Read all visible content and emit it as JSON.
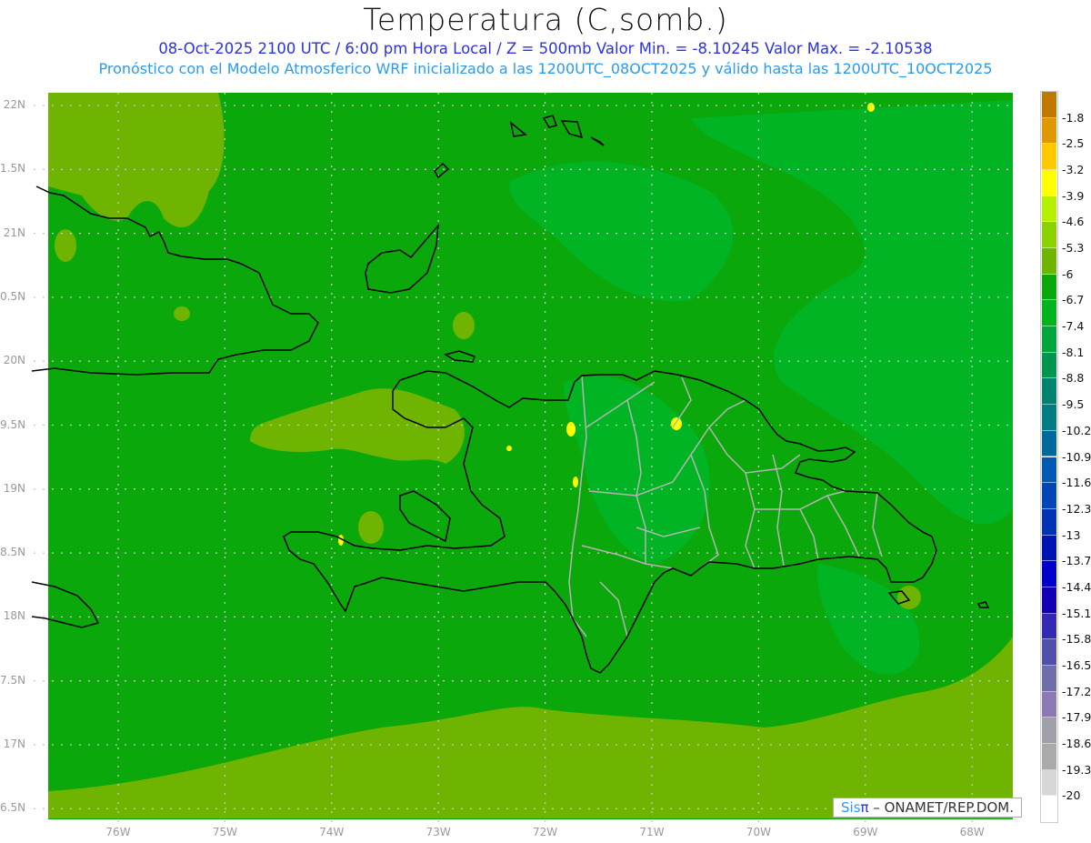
{
  "header": {
    "title": "Temperatura (C,somb.)",
    "subtitle": "08-Oct-2025  2100 UTC / 6:00 pm Hora Local / Z = 500mb  Valor Min. = -8.10245  Valor Max. = -2.10538",
    "description": "Pronóstico con el Modelo Atmosferico WRF inicializado a las 1200UTC_08OCT2025 y válido hasta las  1200UTC_10OCT2025"
  },
  "map": {
    "lat_labels": [
      "22N",
      "1.5N",
      "21N",
      "0.5N",
      "20N",
      "9.5N",
      "19N",
      "8.5N",
      "18N",
      "7.5N",
      "17N",
      "6.5N"
    ],
    "lon_labels": [
      "76W",
      "75W",
      "74W",
      "73W",
      "72W",
      "71W",
      "70W",
      "69W",
      "68W"
    ],
    "colors": {
      "base": "#0aa80a",
      "light": "#00b424",
      "warm": "#6eb400",
      "coast": "#000000",
      "provinces": "#b4b4b4"
    }
  },
  "colorbar": {
    "labels": [
      "-1.8",
      "-2.5",
      "-3.2",
      "-3.9",
      "-4.6",
      "-5.3",
      "-6",
      "-6.7",
      "-7.4",
      "-8.1",
      "-8.8",
      "-9.5",
      "-10.2",
      "-10.9",
      "-11.6",
      "-12.3",
      "-13",
      "-13.7",
      "-14.4",
      "-15.1",
      "-15.8",
      "-16.5",
      "-17.2",
      "-17.9",
      "-18.6",
      "-19.3",
      "-20"
    ],
    "colors": [
      "#c07800",
      "#e09800",
      "#ffc800",
      "#ffff00",
      "#b4f000",
      "#8cd200",
      "#6eb400",
      "#0aa80a",
      "#00b41e",
      "#00a53c",
      "#009650",
      "#00826e",
      "#007d82",
      "#00699b",
      "#005ab4",
      "#0046b4",
      "#0032b4",
      "#0014b4",
      "#0000c8",
      "#1400b4",
      "#3228b4",
      "#5050aa",
      "#6e6eaa",
      "#8c78b4",
      "#a0a0aa",
      "#aaaaaa",
      "#d7d7d7",
      "#ffffff"
    ]
  },
  "logo": {
    "part1": "Sis",
    "part2": "π",
    "part3": " –  ONAMET/REP.DOM."
  }
}
